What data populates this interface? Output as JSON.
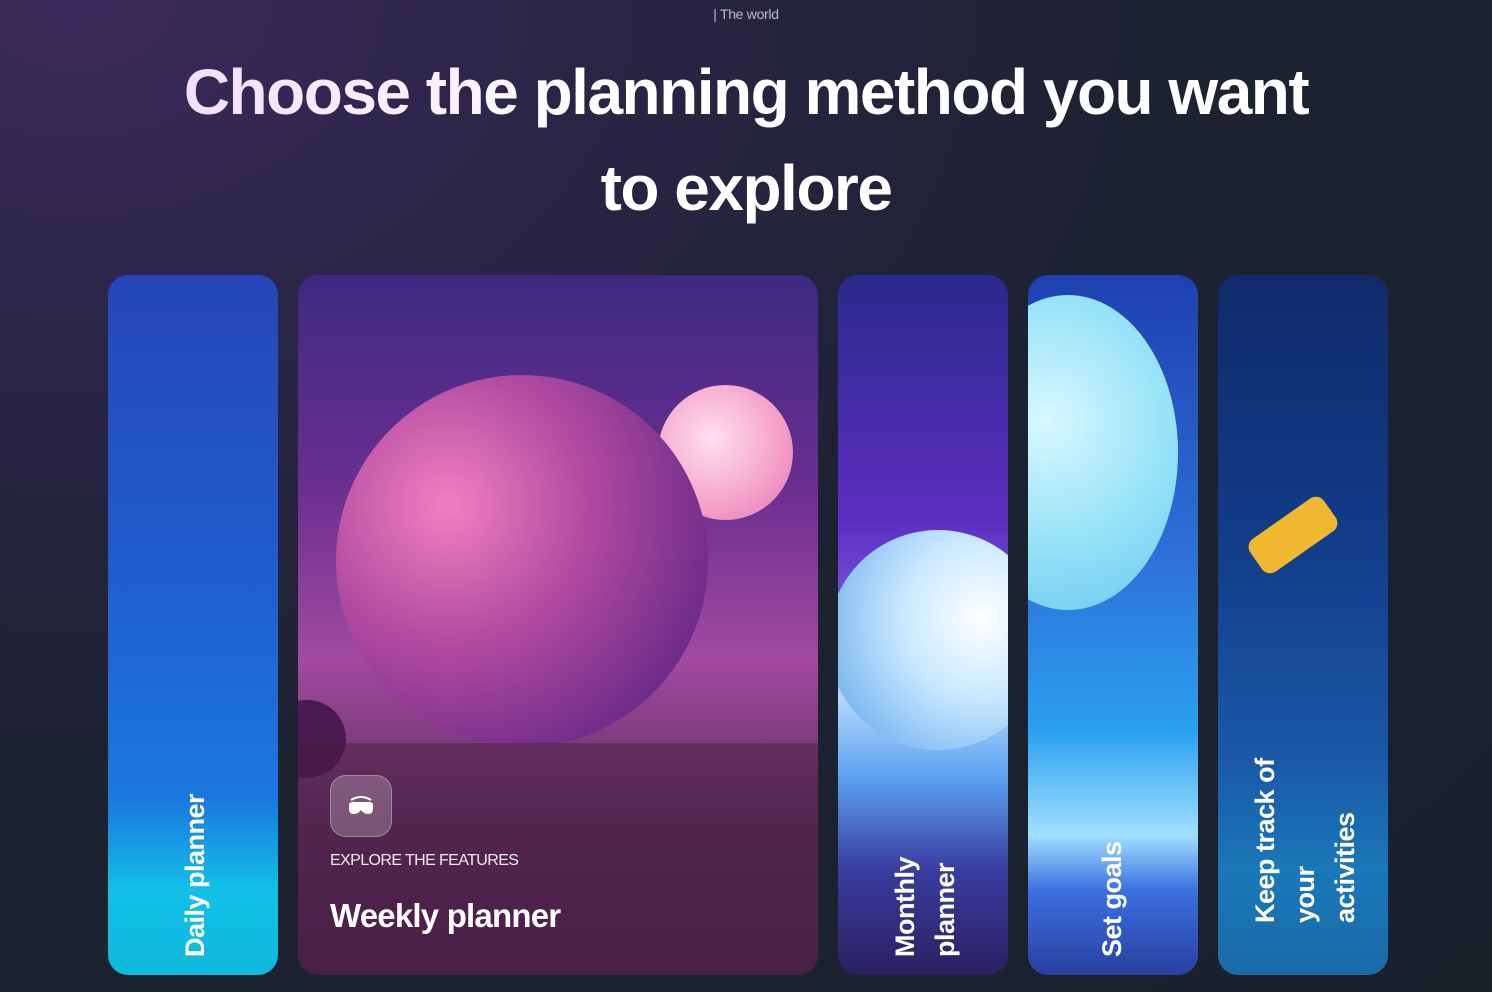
{
  "header": {
    "eyebrow": "| The world",
    "title_line1": "Choose the planning method you want",
    "title_line2": "to explore"
  },
  "cards": [
    {
      "label": "Daily planner",
      "lines": [
        "Daily planner"
      ]
    },
    {
      "label": "Weekly planner",
      "eyebrow": "EXPLORE THE FEATURES",
      "icon": "vr-headset-icon",
      "expanded": true
    },
    {
      "label": "Monthly planner",
      "lines": [
        "Monthly",
        "planner"
      ]
    },
    {
      "label": "Set goals",
      "lines": [
        "Set goals"
      ]
    },
    {
      "label": "Keep track of your activities",
      "lines": [
        "Keep track of",
        "your",
        "activities"
      ]
    }
  ]
}
